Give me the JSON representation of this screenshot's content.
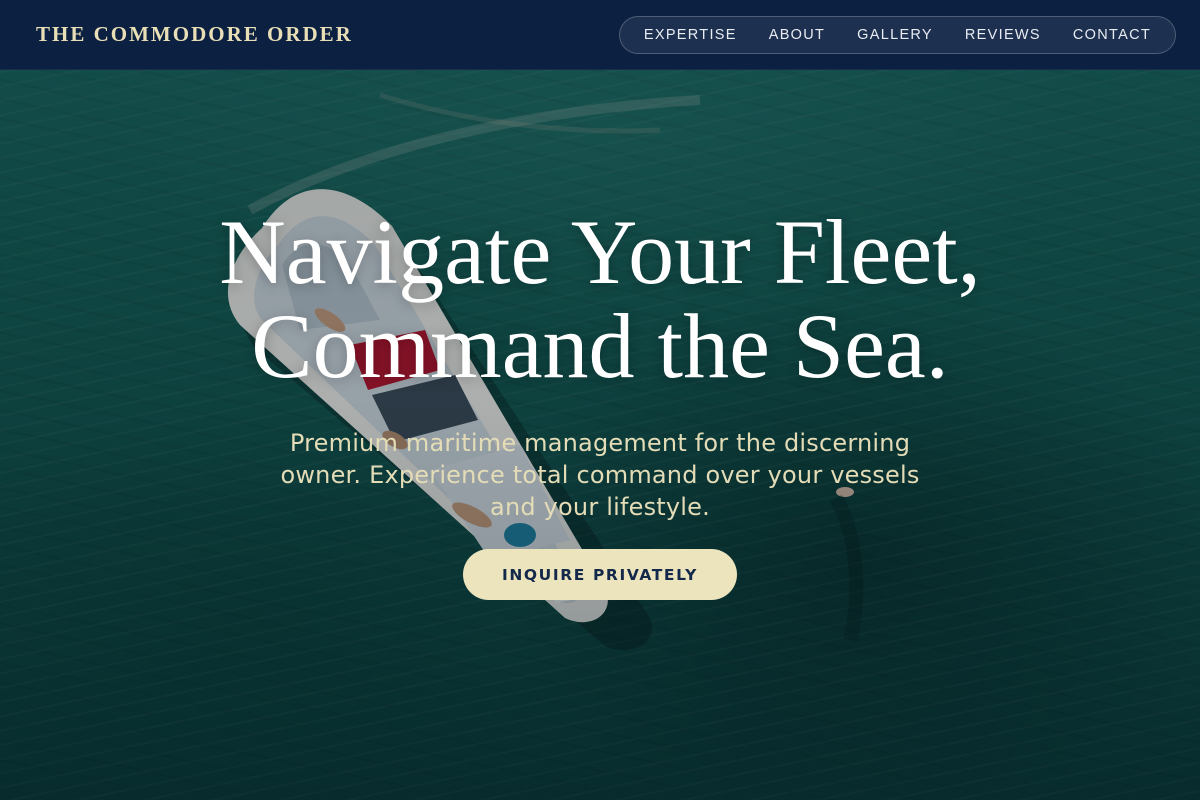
{
  "header": {
    "brand": "THE COMMODORE ORDER",
    "nav": [
      {
        "label": "EXPERTISE"
      },
      {
        "label": "ABOUT"
      },
      {
        "label": "GALLERY"
      },
      {
        "label": "REVIEWS"
      },
      {
        "label": "CONTACT"
      }
    ]
  },
  "hero": {
    "headline_line1": "Navigate Your Fleet,",
    "headline_line2": "Command the Sea.",
    "subtext": "Premium maritime management for the discerning owner. Experience total command over your vessels and your lifestyle.",
    "cta_label": "INQUIRE PRIVATELY",
    "background_image": "aerial-speedboat-ocean"
  },
  "colors": {
    "header_bg": "#0c2142",
    "brand_gold": "#e8dfb6",
    "cta_bg": "#ebe4bd",
    "cta_text": "#13284a",
    "ocean": "#135a52"
  }
}
